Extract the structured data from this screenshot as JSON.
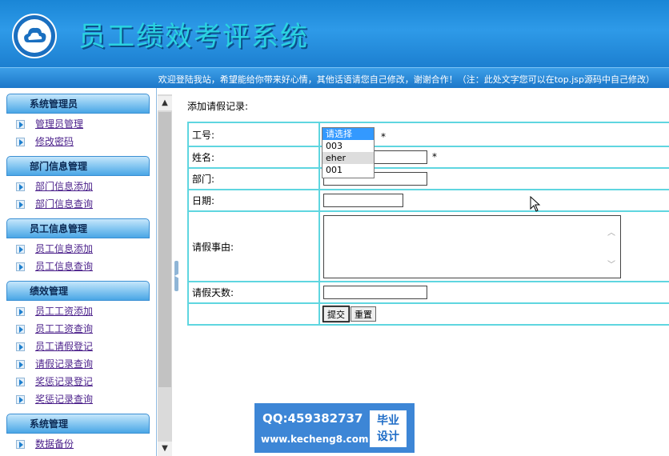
{
  "header": {
    "title": "员工绩效考评系统",
    "banner": "欢迎登陆我站，希望能给你带来好心情，其他话语请您自己修改，谢谢合作！（注：此处文字您可以在top.jsp源码中自己修改）"
  },
  "sidebar": {
    "groups": [
      {
        "title": "系统管理员",
        "items": [
          "管理员管理",
          "修改密码"
        ]
      },
      {
        "title": "部门信息管理",
        "items": [
          "部门信息添加",
          "部门信息查询"
        ]
      },
      {
        "title": "员工信息管理",
        "items": [
          "员工信息添加",
          "员工信息查询"
        ]
      },
      {
        "title": "绩效管理",
        "items": [
          "员工工资添加",
          "员工工资查询",
          "员工请假登记",
          "请假记录查询",
          "奖惩记录登记",
          "奖惩记录查询"
        ]
      },
      {
        "title": "系统管理",
        "items": [
          "数据备份"
        ]
      }
    ]
  },
  "form": {
    "title": "添加请假记录:",
    "rows": {
      "employee_id": {
        "label": "工号:",
        "required": "*"
      },
      "name": {
        "label": "姓名:",
        "value": "",
        "required": "*"
      },
      "department": {
        "label": "部门:",
        "value": ""
      },
      "date": {
        "label": "日期:",
        "value": ""
      },
      "reason": {
        "label": "请假事由:",
        "value": ""
      },
      "days": {
        "label": "请假天数:",
        "value": ""
      }
    },
    "dropdown_options": [
      "请选择",
      "003",
      "eher",
      "001"
    ],
    "submit_label": "提交",
    "reset_label": "重置"
  },
  "watermark": {
    "qq": "QQ:459382737",
    "url": "www.kecheng8.com",
    "badge_line1": "毕业",
    "badge_line2": "设计"
  },
  "colors": {
    "header": "#1a86d6",
    "title_text": "#2ad3e0",
    "table_border": "#5fd6e0",
    "nav_link": "#4a1f8a",
    "watermark_bg": "#3d86d6"
  }
}
